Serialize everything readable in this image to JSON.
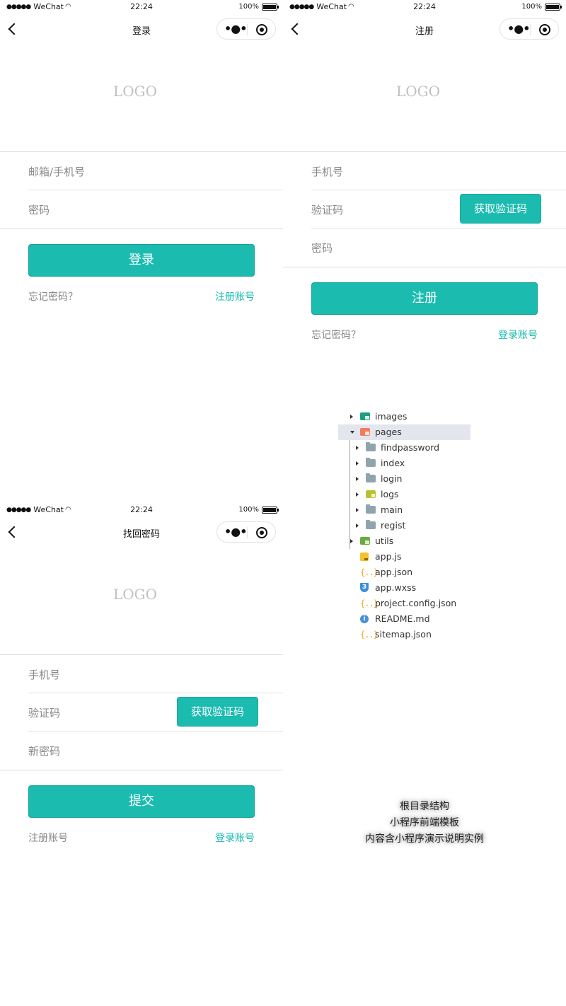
{
  "status_bar": {
    "signal": "●●●●●",
    "carrier": "WeChat",
    "time": "22:24",
    "battery": "100%",
    "battery_level": 1.0
  },
  "login": {
    "nav_title": "登录",
    "logo": "LOGO",
    "fields": [
      "邮箱/手机号",
      "密码"
    ],
    "submit": "登录",
    "link_left": "忘记密码？",
    "link_right": "注册账号"
  },
  "regist": {
    "nav_title": "注册",
    "logo": "LOGO",
    "fields": [
      "手机号",
      "验证码",
      "密码"
    ],
    "code_button": "获取验证码",
    "submit": "注册",
    "link_left": "忘记密码？",
    "link_right": "登录账号"
  },
  "findpassword": {
    "nav_title": "找回密码",
    "logo": "LOGO",
    "fields": [
      "手机号",
      "验证码",
      "新密码"
    ],
    "code_button": "获取验证码",
    "submit": "提交",
    "link_left": "注册账号",
    "link_right": "登录账号"
  },
  "capsule": {
    "more_icon": "•●•"
  },
  "file_tree": [
    {
      "label": "images",
      "icon": "folder-images-icon",
      "depth": 0,
      "arrow": "right"
    },
    {
      "label": "pages",
      "icon": "folder-pages-icon",
      "depth": 0,
      "arrow": "down",
      "selected": true
    },
    {
      "label": "findpassword",
      "icon": "folder-icon",
      "depth": 1,
      "arrow": "right"
    },
    {
      "label": "index",
      "icon": "folder-icon",
      "depth": 1,
      "arrow": "right"
    },
    {
      "label": "login",
      "icon": "folder-icon",
      "depth": 1,
      "arrow": "right"
    },
    {
      "label": "logs",
      "icon": "folder-logs-icon",
      "depth": 1,
      "arrow": "right"
    },
    {
      "label": "main",
      "icon": "folder-icon",
      "depth": 1,
      "arrow": "right"
    },
    {
      "label": "regist",
      "icon": "folder-icon",
      "depth": 1,
      "arrow": "right"
    },
    {
      "label": "utils",
      "icon": "folder-utils-icon",
      "depth": 0,
      "arrow": "right"
    },
    {
      "label": "app.js",
      "icon": "js-file-icon",
      "depth": 0
    },
    {
      "label": "app.json",
      "icon": "json-file-icon",
      "depth": 0
    },
    {
      "label": "app.wxss",
      "icon": "css-file-icon",
      "depth": 0
    },
    {
      "label": "project.config.json",
      "icon": "json-file-icon",
      "depth": 0
    },
    {
      "label": "README.md",
      "icon": "info-file-icon",
      "depth": 0
    },
    {
      "label": "sitemap.json",
      "icon": "json-file-icon",
      "depth": 0
    }
  ],
  "caption": [
    "根目录结构",
    "小程序前端模板",
    "内容含小程序演示说明实例"
  ],
  "colors": {
    "accent": "#1bbbb0",
    "placeholder": "#888888",
    "logo": "#c0c0c0"
  }
}
